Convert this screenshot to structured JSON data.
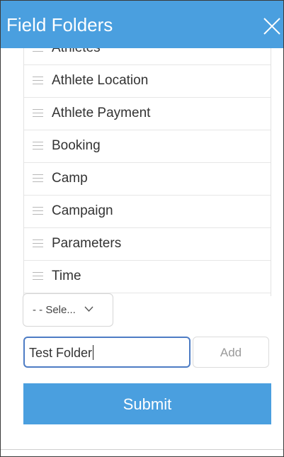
{
  "dialog": {
    "title": "Field Folders",
    "close_icon": "close-icon"
  },
  "folders": [
    {
      "label": "Athletes",
      "icon": "drag-handle-icon"
    },
    {
      "label": "Athlete Location",
      "icon": "drag-handle-icon"
    },
    {
      "label": "Athlete Payment",
      "icon": "drag-handle-icon"
    },
    {
      "label": "Booking",
      "icon": "drag-handle-icon"
    },
    {
      "label": "Camp",
      "icon": "drag-handle-icon"
    },
    {
      "label": "Campaign",
      "icon": "drag-handle-icon"
    },
    {
      "label": "Parameters",
      "icon": "drag-handle-icon"
    },
    {
      "label": "Time",
      "icon": "drag-handle-icon"
    }
  ],
  "parent_select": {
    "value": "- - Sele...",
    "icon": "chevron-down-icon"
  },
  "new_folder": {
    "value": "Test Folder",
    "add_label": "Add"
  },
  "submit_label": "Submit",
  "colors": {
    "accent": "#4a9fdf",
    "focus_border": "#4d7cc4"
  }
}
